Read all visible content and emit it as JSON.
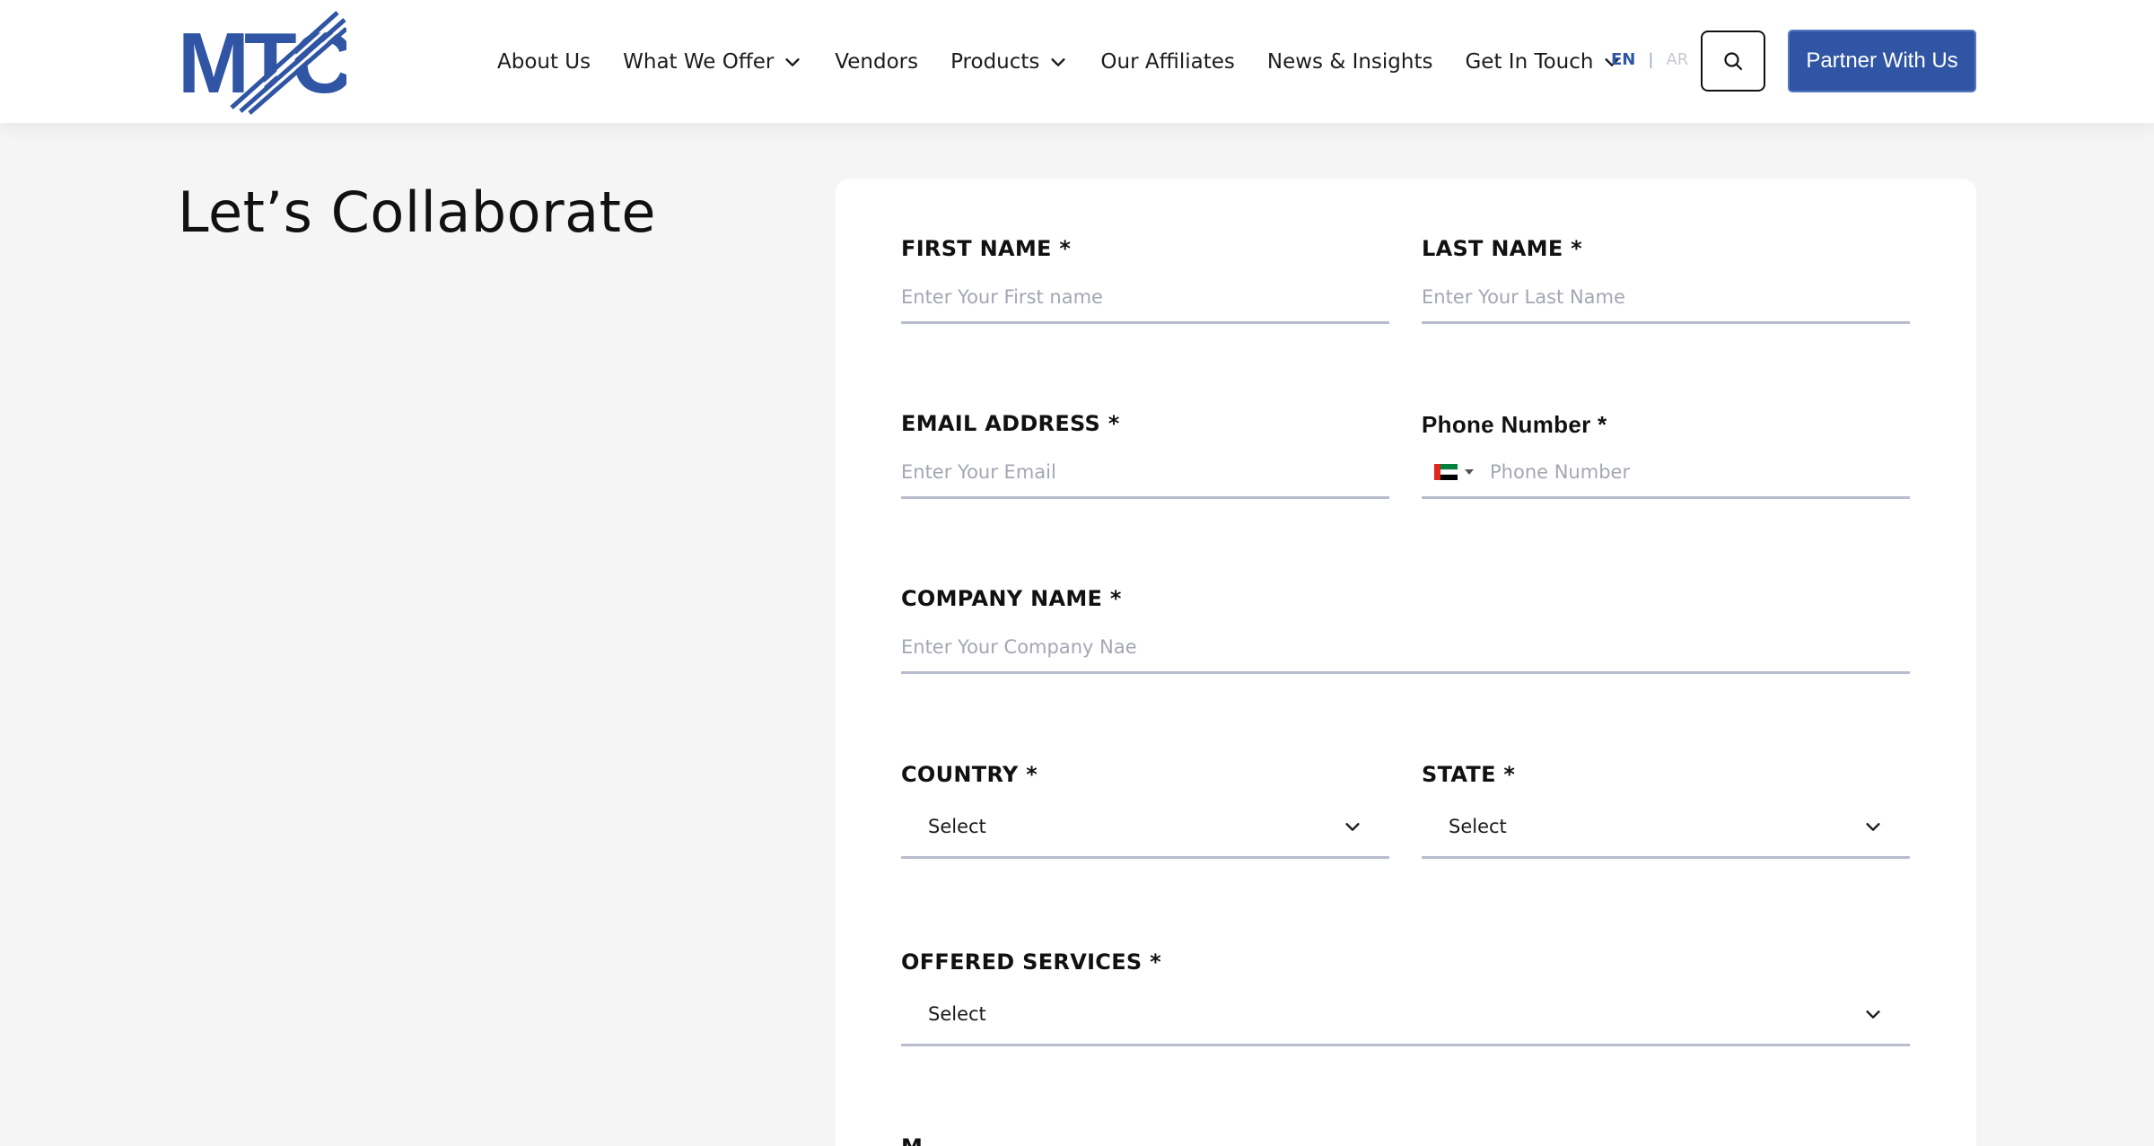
{
  "header": {
    "logo_text": "MTC",
    "nav": [
      {
        "label": "About Us",
        "dropdown": false
      },
      {
        "label": "What We Offer",
        "dropdown": true
      },
      {
        "label": "Vendors",
        "dropdown": false
      },
      {
        "label": "Products",
        "dropdown": true
      },
      {
        "label": "Our Affiliates",
        "dropdown": false
      },
      {
        "label": "News & Insights",
        "dropdown": false
      },
      {
        "label": "Get In Touch",
        "dropdown": true
      }
    ],
    "lang_en": "EN",
    "lang_sep": "|",
    "lang_ar": "AR",
    "search_icon": "search-icon",
    "partner_label": "Partner With Us"
  },
  "page": {
    "title": "Let’s Collaborate"
  },
  "form": {
    "first_name": {
      "label": "FIRST NAME *",
      "placeholder": "Enter Your First name"
    },
    "last_name": {
      "label": "LAST NAME *",
      "placeholder": "Enter Your Last Name"
    },
    "email": {
      "label": "EMAIL ADDRESS *",
      "placeholder": "Enter Your Email"
    },
    "phone": {
      "label": "Phone Number *",
      "placeholder": "Phone Number",
      "flag": "UAE flag"
    },
    "company": {
      "label": "COMPANY NAME *",
      "placeholder": "Enter Your Company Nae"
    },
    "country": {
      "label": "COUNTRY *",
      "value": "Select"
    },
    "state": {
      "label": "STATE *",
      "value": "Select"
    },
    "services": {
      "label": "OFFERED SERVICES *",
      "value": "Select"
    },
    "next_label_partial": "M"
  },
  "colors": {
    "brand": "#2f55a4",
    "page_bg": "#f5f5f5",
    "input_border": "#b9bccc",
    "placeholder": "#a3a7b2"
  }
}
